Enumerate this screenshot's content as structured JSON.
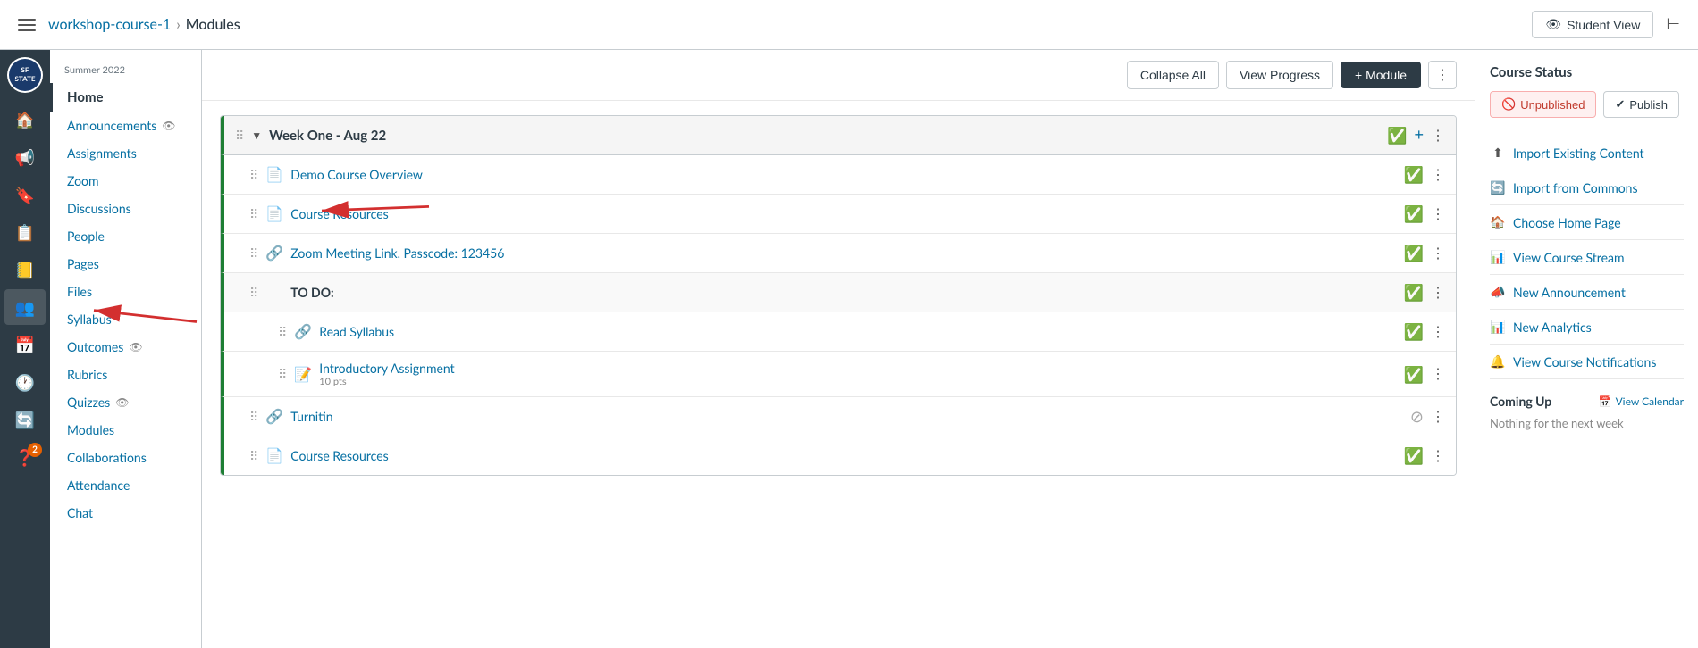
{
  "topNav": {
    "hamburger_label": "Menu",
    "breadcrumb_link": "workshop-course-1",
    "breadcrumb_sep": "›",
    "breadcrumb_current": "Modules",
    "student_view_label": "Student View",
    "collapse_nav_label": "Collapse navigation"
  },
  "iconSidebar": {
    "items": [
      {
        "icon": "🏠",
        "label": "home-icon",
        "active": false
      },
      {
        "icon": "📢",
        "label": "announcements-icon",
        "active": false
      },
      {
        "icon": "🔖",
        "label": "bookmark-icon",
        "active": false
      },
      {
        "icon": "📋",
        "label": "assignments-icon",
        "active": false
      },
      {
        "icon": "📒",
        "label": "notebook-icon",
        "active": false
      },
      {
        "icon": "👥",
        "label": "people-icon",
        "active": false
      },
      {
        "icon": "📅",
        "label": "calendar-icon",
        "active": false
      },
      {
        "icon": "🕐",
        "label": "clock-icon",
        "active": false
      },
      {
        "icon": "🔄",
        "label": "refresh-icon",
        "active": false
      },
      {
        "icon": "❓",
        "label": "help-icon",
        "active": false,
        "badge": "2"
      }
    ]
  },
  "textNav": {
    "term": "Summer 2022",
    "items": [
      {
        "label": "Home",
        "active": true,
        "eye": false
      },
      {
        "label": "Announcements",
        "active": false,
        "eye": true
      },
      {
        "label": "Assignments",
        "active": false,
        "eye": false
      },
      {
        "label": "Zoom",
        "active": false,
        "eye": false
      },
      {
        "label": "Discussions",
        "active": false,
        "eye": false
      },
      {
        "label": "People",
        "active": false,
        "eye": false
      },
      {
        "label": "Pages",
        "active": false,
        "eye": false
      },
      {
        "label": "Files",
        "active": false,
        "eye": false
      },
      {
        "label": "Syllabus",
        "active": false,
        "eye": false
      },
      {
        "label": "Outcomes",
        "active": false,
        "eye": true
      },
      {
        "label": "Rubrics",
        "active": false,
        "eye": false
      },
      {
        "label": "Quizzes",
        "active": false,
        "eye": true
      },
      {
        "label": "Modules",
        "active": false,
        "eye": false
      },
      {
        "label": "Collaborations",
        "active": false,
        "eye": false
      },
      {
        "label": "Attendance",
        "active": false,
        "eye": false
      },
      {
        "label": "Chat",
        "active": false,
        "eye": false
      }
    ]
  },
  "contentHeader": {
    "collapse_all_label": "Collapse All",
    "view_progress_label": "View Progress",
    "add_module_label": "+ Module"
  },
  "modules": [
    {
      "title": "Week One - Aug 22",
      "published": true,
      "items": [
        {
          "icon": "📄",
          "title": "Demo Course Overview",
          "subtitle": "",
          "published": true,
          "indented": false,
          "type": "page"
        },
        {
          "icon": "📄",
          "title": "Course Resources",
          "subtitle": "",
          "published": true,
          "indented": false,
          "type": "page"
        },
        {
          "icon": "🔗",
          "title": "Zoom Meeting Link. Passcode: 123456",
          "subtitle": "",
          "published": true,
          "indented": false,
          "type": "link"
        },
        {
          "icon": "",
          "title": "TO DO:",
          "subtitle": "",
          "published": true,
          "indented": false,
          "type": "header"
        },
        {
          "icon": "🔗",
          "title": "Read Syllabus",
          "subtitle": "",
          "published": true,
          "indented": true,
          "type": "link"
        },
        {
          "icon": "📝",
          "title": "Introductory Assignment",
          "subtitle": "10 pts",
          "published": true,
          "indented": true,
          "type": "assignment"
        },
        {
          "icon": "🔗",
          "title": "Turnitin",
          "subtitle": "",
          "published": false,
          "indented": false,
          "type": "link"
        },
        {
          "icon": "📄",
          "title": "Course Resources",
          "subtitle": "",
          "published": true,
          "indented": false,
          "type": "page"
        }
      ]
    }
  ],
  "rightSidebar": {
    "course_status_title": "Course Status",
    "unpublished_label": "Unpublished",
    "publish_label": "Publish",
    "actions": [
      {
        "icon": "⬆",
        "label": "Import Existing Content"
      },
      {
        "icon": "🔄",
        "label": "Import from Commons"
      },
      {
        "icon": "🏠",
        "label": "Choose Home Page"
      },
      {
        "icon": "📊",
        "label": "View Course Stream"
      },
      {
        "icon": "📣",
        "label": "New Announcement"
      },
      {
        "icon": "📊",
        "label": "New Analytics"
      },
      {
        "icon": "🔔",
        "label": "View Course Notifications"
      }
    ],
    "coming_up_title": "Coming Up",
    "view_calendar_label": "View Calendar",
    "coming_up_empty": "Nothing for the next week"
  }
}
